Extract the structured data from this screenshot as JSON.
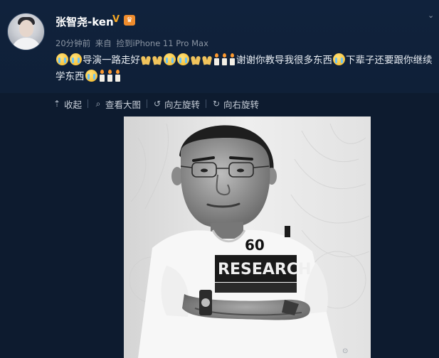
{
  "post": {
    "username": "张智尧-ken",
    "verified_badge": "V",
    "vip_badge": "♛",
    "time": "20分钟前",
    "source_prefix": "来自",
    "source_device": "捡到iPhone 11 Pro Max",
    "text_segments": [
      "导演一路走好",
      "谢谢你教导我很多东西",
      "下辈子还要跟你继续学东西"
    ]
  },
  "toolbar": {
    "collapse_label": "收起",
    "view_large_label": "查看大图",
    "rotate_left_label": "向左旋转",
    "rotate_right_label": "向右旋转"
  },
  "photo": {
    "shirt_number": "60",
    "shirt_text": "RESEARCH"
  },
  "icons": {
    "collapse": "arrow-up-icon",
    "view_large": "magnifier-icon",
    "rotate_left": "rotate-left-icon",
    "rotate_right": "rotate-right-icon",
    "menu": "chevron-down-icon"
  },
  "colors": {
    "background": "#0d1b2f",
    "header_bg": "#10223c",
    "name": "#ffffff",
    "meta": "#8b95a3",
    "toolbar_text": "#c7ced8"
  }
}
